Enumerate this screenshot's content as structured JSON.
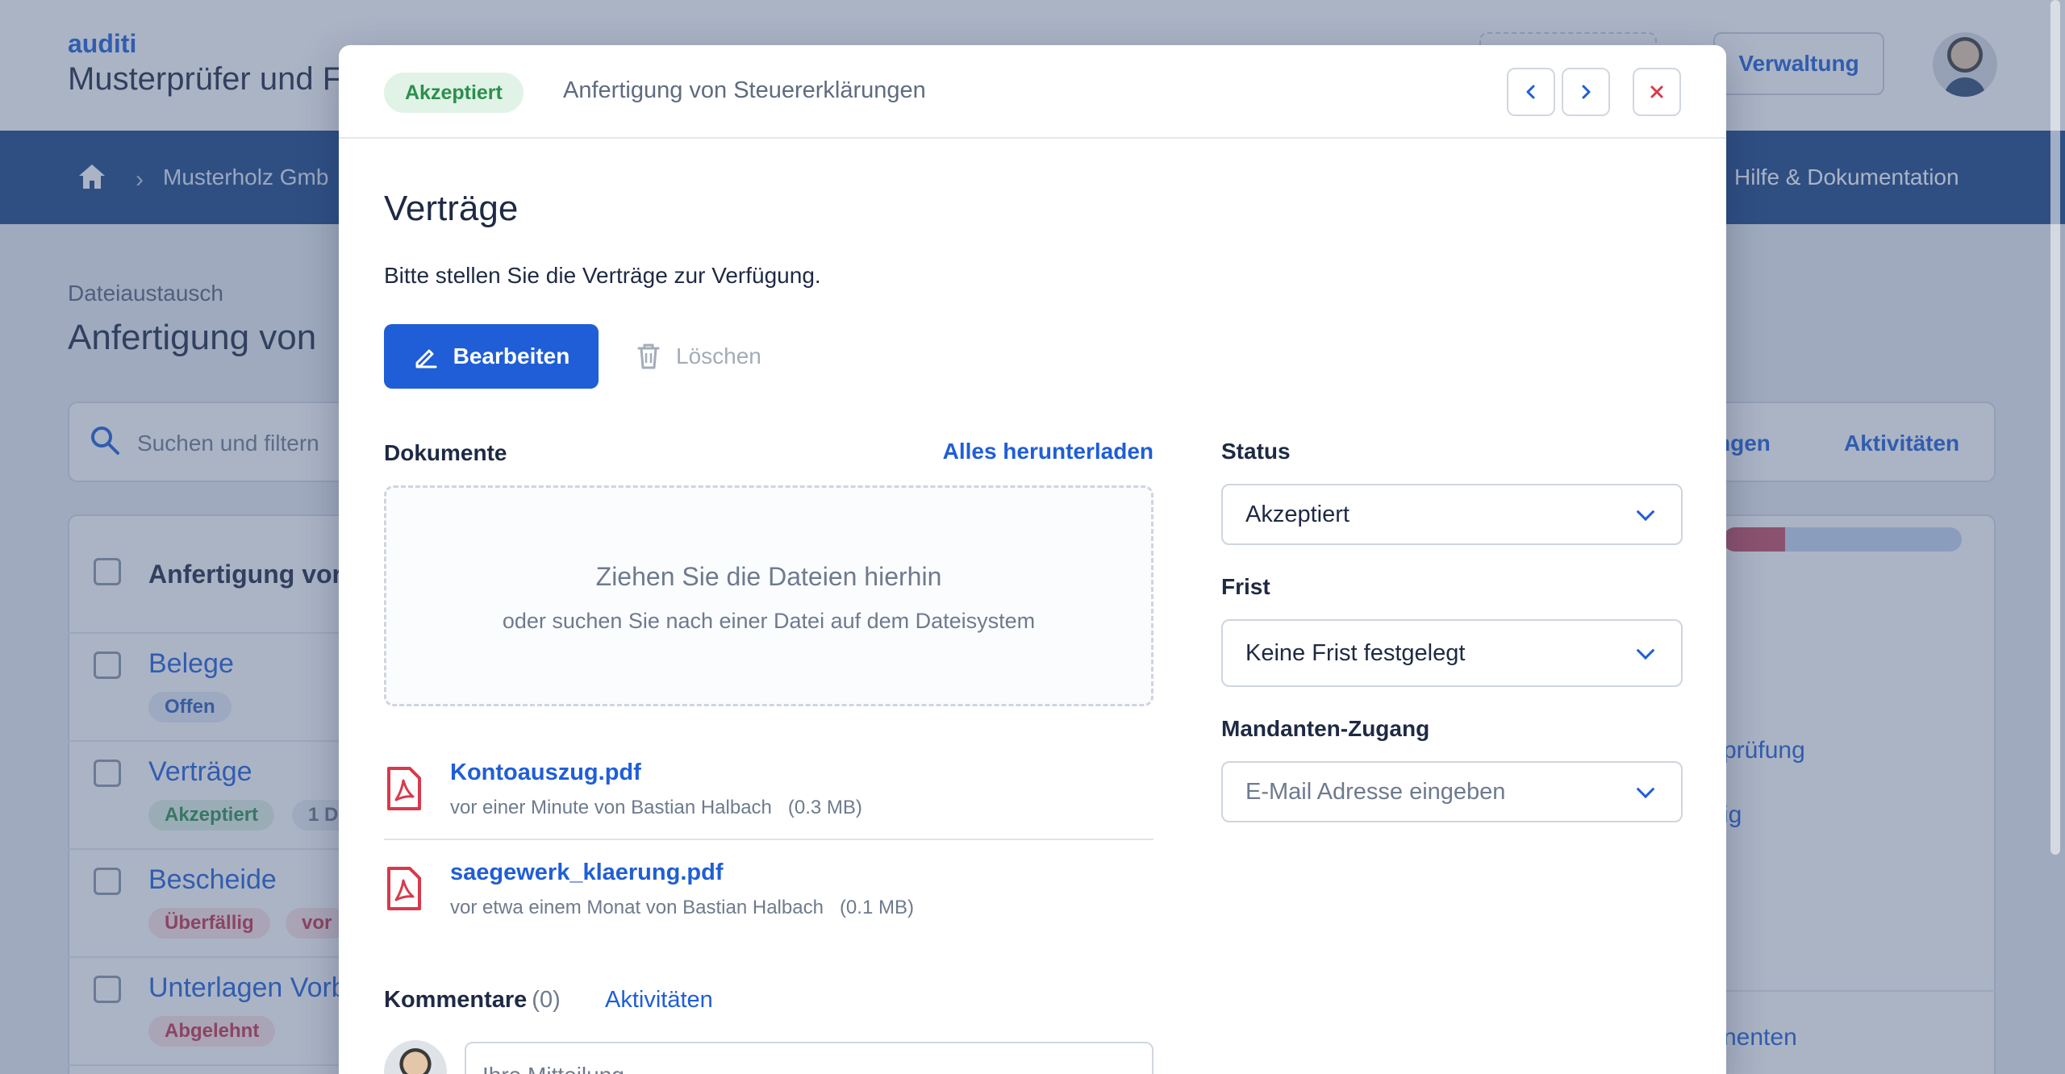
{
  "app": {
    "brand": "auditi",
    "company": "Musterprüfer und F",
    "admin_button": "Verwaltung"
  },
  "nav": {
    "breadcrumb": "Musterholz Gmb",
    "help": "Hilfe & Dokumentation"
  },
  "page": {
    "section": "Dateiaustausch",
    "title": "Anfertigung von",
    "search_placeholder": "Suchen und filtern",
    "right_tabs": [
      "ngen",
      "Aktivitäten"
    ],
    "list_header": "Anfertigung vor",
    "rows": [
      {
        "title": "Belege",
        "badges": [
          "Offen"
        ]
      },
      {
        "title": "Verträge",
        "badges": [
          "Akzeptiert",
          "1 D"
        ]
      },
      {
        "title": "Bescheide",
        "badges": [
          "Überfällig",
          "vor"
        ]
      },
      {
        "title": "Unterlagen Vorb",
        "badges": [
          "Abgelehnt"
        ]
      }
    ],
    "right_links": [
      "prüfung",
      "ig",
      "nenten"
    ],
    "progress_fraction": 0.26
  },
  "modal": {
    "status_badge": "Akzeptiert",
    "header_title": "Anfertigung von Steuererklärungen",
    "title": "Verträge",
    "description": "Bitte stellen Sie die Verträge zur Verfügung.",
    "edit_button": "Bearbeiten",
    "delete_button": "Löschen",
    "documents_label": "Dokumente",
    "download_all": "Alles herunterladen",
    "dropzone_title": "Ziehen Sie die Dateien hierhin",
    "dropzone_sub": "oder suchen Sie nach einer Datei auf dem Dateisystem",
    "files": [
      {
        "name": "Kontoauszug.pdf",
        "meta": "vor einer Minute von Bastian Halbach",
        "size": "(0.3 MB)"
      },
      {
        "name": "saegewerk_klaerung.pdf",
        "meta": "vor etwa einem Monat von Bastian Halbach",
        "size": "(0.1 MB)"
      }
    ],
    "comments_label": "Kommentare",
    "comments_count": "(0)",
    "activities_link": "Aktivitäten",
    "comment_placeholder": "Ihre Mitteilung",
    "status_label": "Status",
    "status_value": "Akzeptiert",
    "deadline_label": "Frist",
    "deadline_value": "Keine Frist festgelegt",
    "client_access_label": "Mandanten-Zugang",
    "client_access_placeholder": "E-Mail Adresse eingeben"
  },
  "colors": {
    "accent": "#1f5ed6",
    "navbar": "#1a4585",
    "accepted_bg": "#e0f3e6",
    "accepted_fg": "#2c8f4c",
    "overdue_fg": "#c2334a",
    "pdf_red": "#d83a4b"
  },
  "icons": {
    "home": "home-icon",
    "search": "search-icon",
    "edit": "pencil-icon",
    "delete": "trash-icon",
    "prev": "chevron-left-icon",
    "next": "chevron-right-icon",
    "close": "close-icon",
    "file": "pdf-file-icon",
    "dropdown": "chevron-down-icon"
  }
}
